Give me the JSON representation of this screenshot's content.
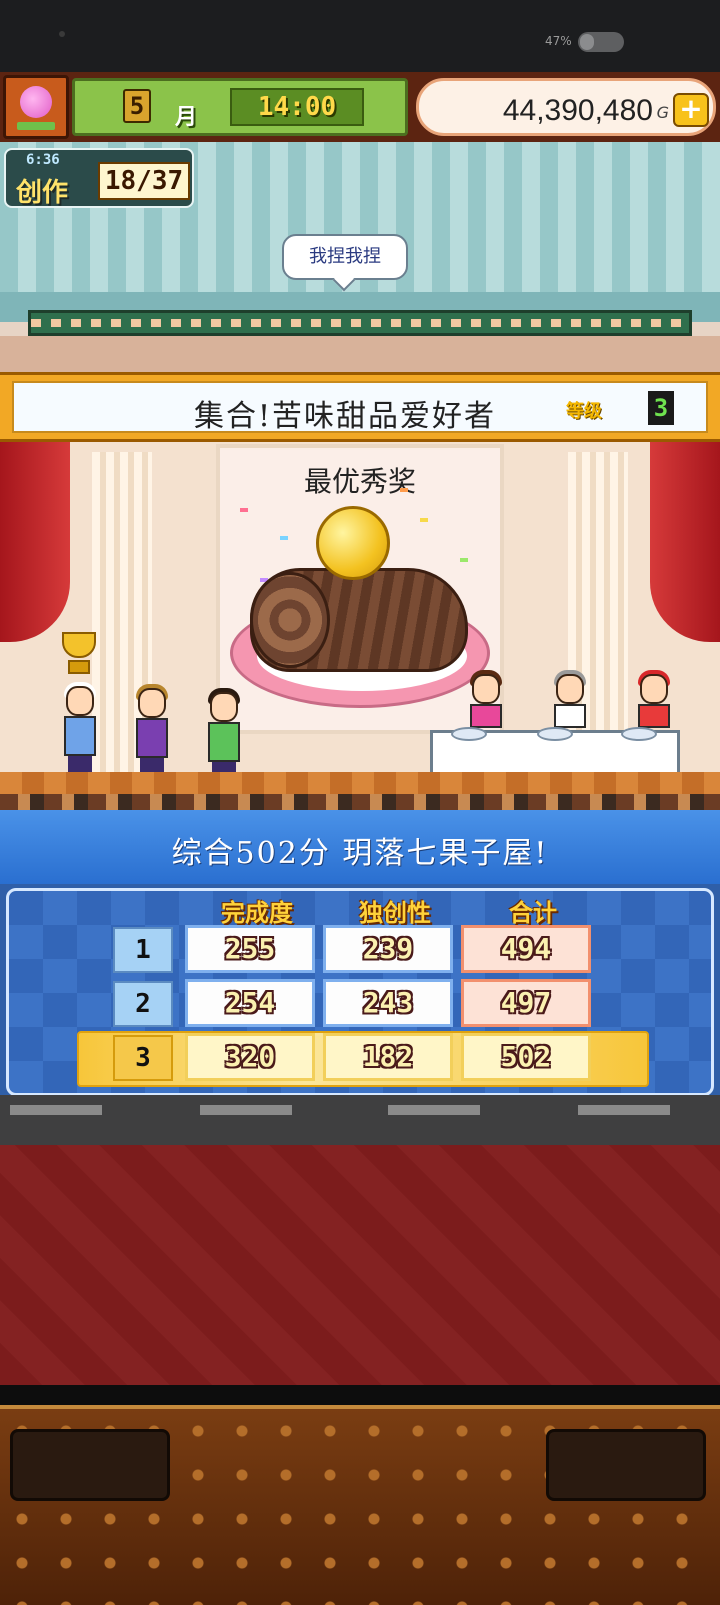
{
  "status_bar": {
    "battery": "47%"
  },
  "hud": {
    "month_number": "5",
    "month_label": "月",
    "time": "14:00",
    "money": "44,390,480",
    "money_unit": "G",
    "add_label": "+"
  },
  "creation": {
    "timer": "6:36",
    "label": "创作",
    "progress": "18/37"
  },
  "speech_bubble": "我捏我捏",
  "contest": {
    "title": "集合!苦味甜品爱好者",
    "rank_label": "等级",
    "rank_value": "3"
  },
  "award": {
    "title": "最优秀奖"
  },
  "results": {
    "summary": "综合502分 玥落七果子屋!",
    "columns": [
      "完成度",
      "独创性",
      "合计"
    ],
    "rows": [
      {
        "num": "1",
        "completion": "255",
        "originality": "239",
        "total": "494"
      },
      {
        "num": "2",
        "completion": "254",
        "originality": "243",
        "total": "497"
      },
      {
        "num": "3",
        "completion": "320",
        "originality": "182",
        "total": "502"
      }
    ]
  },
  "colors": {
    "accent_gold": "#f3c22b",
    "banner_blue": "#2a6fd0",
    "total_cell": "#fde2d6"
  }
}
